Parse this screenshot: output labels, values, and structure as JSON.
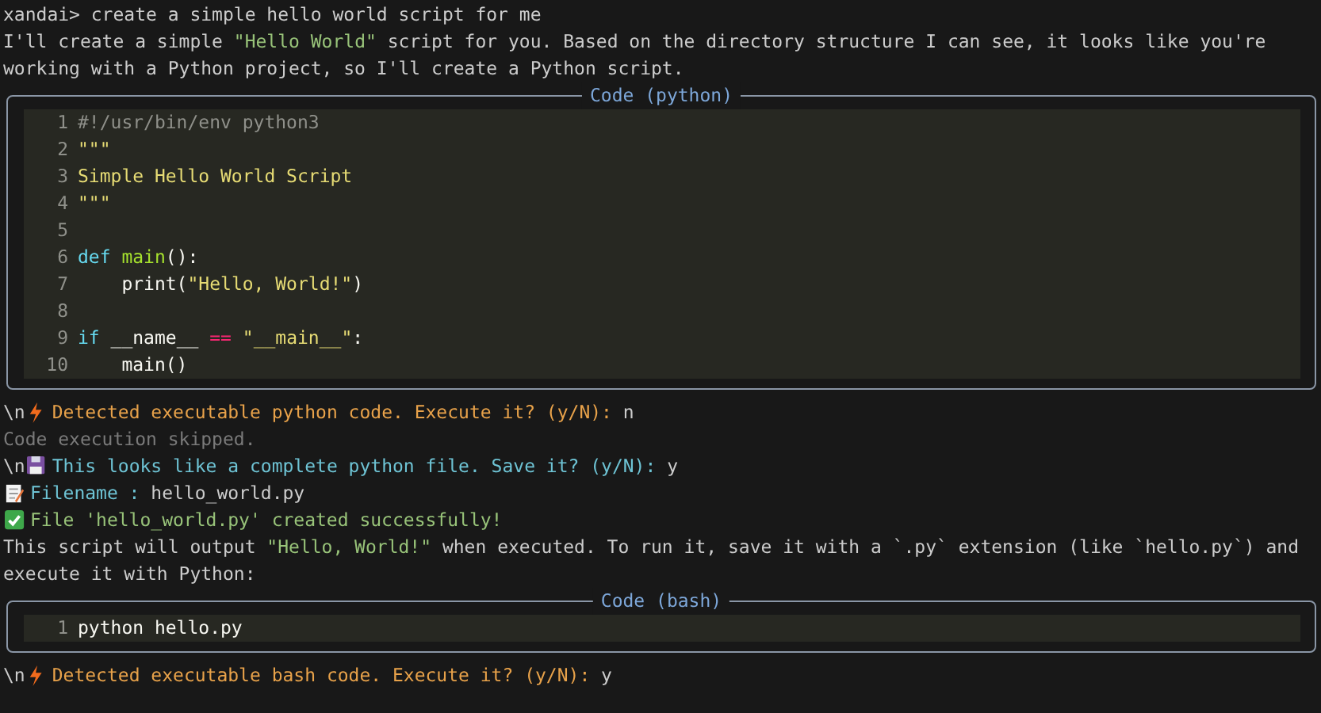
{
  "log": [
    {
      "kind": "prompt",
      "segments": [
        {
          "kind": "plain",
          "text": "xandai> create a simple hello world script for me"
        }
      ]
    },
    {
      "kind": "text",
      "segments": [
        {
          "kind": "plain",
          "text": "I'll create a simple "
        },
        {
          "kind": "quoted",
          "text": "\"Hello World\""
        },
        {
          "kind": "plain",
          "text": " script for you. Based on the directory structure I can see, it looks like you're working with a Python project, so I'll create a Python script."
        }
      ]
    },
    {
      "kind": "code",
      "title": "Code (python)",
      "lines": [
        {
          "number": "1",
          "segments": [
            {
              "kind": "comment",
              "text": "#!/usr/bin/env python3"
            }
          ]
        },
        {
          "number": "2",
          "segments": [
            {
              "kind": "string",
              "text": "\"\"\""
            }
          ]
        },
        {
          "number": "3",
          "segments": [
            {
              "kind": "string",
              "text": "Simple Hello World Script"
            }
          ]
        },
        {
          "number": "4",
          "segments": [
            {
              "kind": "string",
              "text": "\"\"\""
            }
          ]
        },
        {
          "number": "5"
        },
        {
          "number": "6",
          "segments": [
            {
              "kind": "keyword",
              "text": "def "
            },
            {
              "kind": "function",
              "text": "main"
            },
            {
              "kind": "plain",
              "text": "():"
            }
          ]
        },
        {
          "number": "7",
          "segments": [
            {
              "kind": "plain",
              "text": "    print("
            },
            {
              "kind": "string",
              "text": "\"Hello, World!\""
            },
            {
              "kind": "plain",
              "text": ")"
            }
          ]
        },
        {
          "number": "8"
        },
        {
          "number": "9",
          "segments": [
            {
              "kind": "keyword",
              "text": "if"
            },
            {
              "kind": "plain",
              "text": " __name__ "
            },
            {
              "kind": "operator",
              "text": "=="
            },
            {
              "kind": "string",
              "text": " \"__main__\""
            },
            {
              "kind": "plain",
              "text": ":"
            }
          ]
        },
        {
          "number": "10",
          "segments": [
            {
              "kind": "plain",
              "text": "    main()"
            }
          ]
        }
      ]
    },
    {
      "kind": "execute-prompt",
      "prefix": "\\n",
      "segments": [
        {
          "kind": "warn",
          "text": "Detected executable python code. Execute it? (y/N): "
        },
        {
          "kind": "plain",
          "text": "n"
        }
      ]
    },
    {
      "kind": "skipped",
      "segments": [
        {
          "kind": "muted",
          "text": "Code execution skipped."
        }
      ]
    },
    {
      "kind": "save-prompt",
      "prefix": "\\n",
      "segments": [
        {
          "kind": "info",
          "text": "This looks like a complete python file. Save it? (y/N): "
        },
        {
          "kind": "plain",
          "text": "y"
        }
      ]
    },
    {
      "kind": "filename",
      "segments": [
        {
          "kind": "info",
          "text": "Filename : "
        },
        {
          "kind": "plain",
          "text": "hello_world.py"
        }
      ]
    },
    {
      "kind": "created",
      "segments": [
        {
          "kind": "success",
          "text": "File 'hello_world.py' created successfully!"
        }
      ]
    },
    {
      "kind": "text",
      "segments": [
        {
          "kind": "plain",
          "text": "This script will output "
        },
        {
          "kind": "quoted",
          "text": "\"Hello, World!\""
        },
        {
          "kind": "plain",
          "text": " when executed. To run it, save it with a `.py` extension (like `hello.py`) and execute it with Python:"
        }
      ]
    },
    {
      "kind": "code",
      "title": "Code (bash)",
      "lines": [
        {
          "number": "1",
          "segments": [
            {
              "kind": "plain",
              "text": "python hello.py"
            }
          ]
        }
      ]
    },
    {
      "kind": "execute-prompt",
      "prefix": "\\n",
      "segments": [
        {
          "kind": "warn",
          "text": "Detected executable bash code. Execute it? (y/N): "
        },
        {
          "kind": "plain",
          "text": "y"
        }
      ]
    }
  ]
}
